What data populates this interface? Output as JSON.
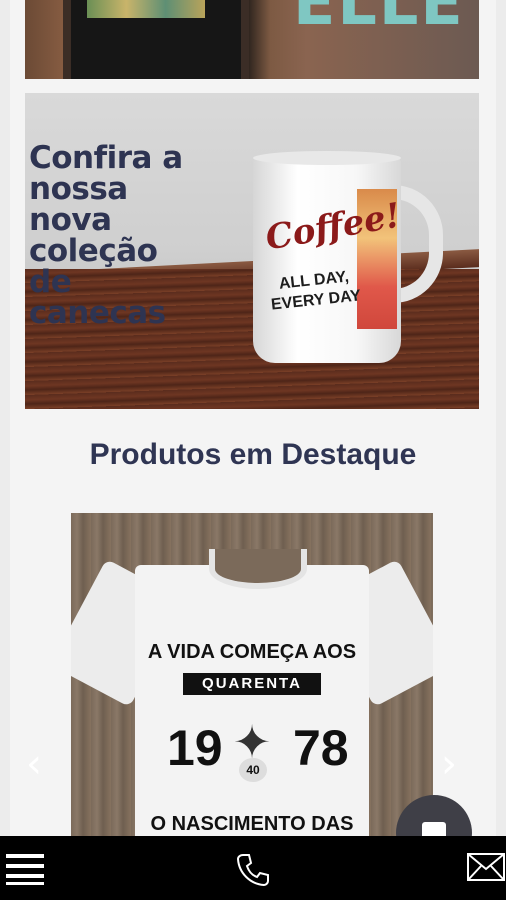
{
  "banner_top": {
    "text": "ELLE"
  },
  "mug_banner": {
    "headline_lines": [
      "Confira a",
      "nossa",
      "nova",
      "coleção",
      "de",
      "canecas"
    ],
    "mug_brand": "Coffee!",
    "mug_slogan": "ALL DAY, EVERY DAY"
  },
  "featured": {
    "title": "Produtos em Destaque",
    "product": {
      "print_top": "A VIDA COMEÇA AOS",
      "print_ribbon": "QUARENTA",
      "year_a": "19",
      "year_b": "78",
      "badge": "40",
      "print_bottom": "O NASCIMENTO DAS"
    },
    "prev_arrow": "‹",
    "next_arrow": "›"
  },
  "bottom_bar": {
    "icons": [
      "menu-icon",
      "phone-icon",
      "mail-icon"
    ]
  }
}
